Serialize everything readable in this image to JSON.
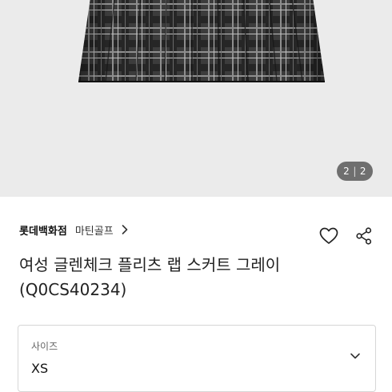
{
  "gallery": {
    "current": "2",
    "total": "2"
  },
  "product": {
    "store": "롯데백화점",
    "brand": "마틴골프",
    "title": "여성 글렌체크 플리츠 랩 스커트 그레이 (Q0CS40234)"
  },
  "icons": {
    "wishlist": "heart-icon",
    "share": "share-icon",
    "brand_link": "chevron-right-icon",
    "select": "chevron-down-icon"
  },
  "options": {
    "size_label": "사이즈",
    "size_value": "XS"
  },
  "colors": {
    "gallery_bg": "#ebebeb",
    "counter_bg": "#464646",
    "fabric_dark": "#2a2a2a",
    "fabric_light": "#9a9a9a"
  }
}
